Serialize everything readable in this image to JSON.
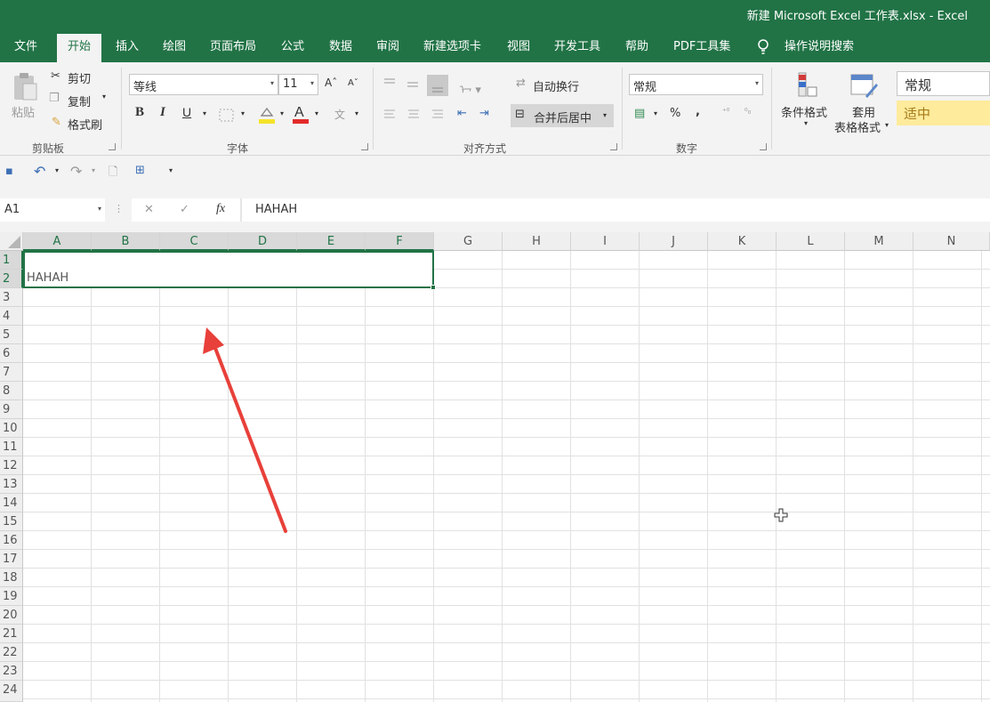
{
  "window": {
    "title": "新建 Microsoft Excel 工作表.xlsx  -  Excel"
  },
  "tabs": [
    {
      "label": "文件"
    },
    {
      "label": "开始"
    },
    {
      "label": "插入"
    },
    {
      "label": "绘图"
    },
    {
      "label": "页面布局"
    },
    {
      "label": "公式"
    },
    {
      "label": "数据"
    },
    {
      "label": "审阅"
    },
    {
      "label": "新建选项卡"
    },
    {
      "label": "视图"
    },
    {
      "label": "开发工具"
    },
    {
      "label": "帮助"
    },
    {
      "label": "PDF工具集"
    }
  ],
  "tell_me": "操作说明搜索",
  "ribbon": {
    "clipboard": {
      "paste": "粘贴",
      "cut": "剪切",
      "copy": "复制",
      "format_painter": "格式刷",
      "label": "剪贴板"
    },
    "font": {
      "name": "等线",
      "size": "11",
      "label": "字体",
      "bold": "B",
      "italic": "I",
      "underline": "U"
    },
    "alignment": {
      "wrap": "自动换行",
      "merge": "合并后居中",
      "label": "对齐方式"
    },
    "number": {
      "format": "常规",
      "percent": "%",
      "comma": ",",
      "label": "数字"
    },
    "styles": {
      "conditional": "条件格式",
      "table_line1": "套用",
      "table_line2": "表格格式",
      "style_normal": "常规",
      "style_neutral": "适中"
    }
  },
  "formula_bar": {
    "name_box": "A1",
    "fx": "fx",
    "value": "HAHAH"
  },
  "columns": [
    "A",
    "B",
    "C",
    "D",
    "E",
    "F",
    "G",
    "H",
    "I",
    "J",
    "K",
    "L",
    "M",
    "N"
  ],
  "rows": [
    "1",
    "2",
    "3",
    "4",
    "5",
    "6",
    "7",
    "8",
    "9",
    "10",
    "11",
    "12",
    "13",
    "14",
    "15",
    "16",
    "17",
    "18",
    "19",
    "20",
    "21",
    "22",
    "23",
    "24"
  ],
  "cell_content": {
    "A2": "HAHAH"
  },
  "colors": {
    "accent": "#217346",
    "arrow": "#e8403a",
    "neutral_style_bg": "#ffeb9c"
  }
}
